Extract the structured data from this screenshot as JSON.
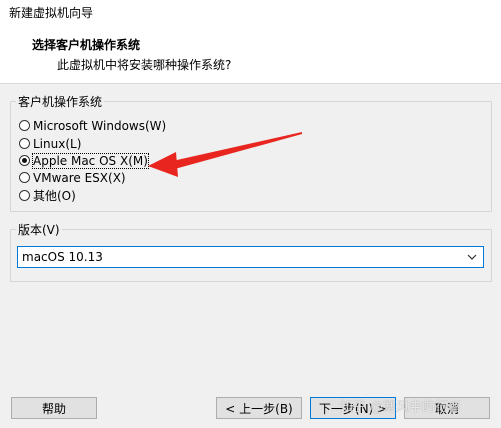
{
  "window": {
    "title": "新建虚拟机向导"
  },
  "header": {
    "title": "选择客户机操作系统",
    "subtitle": "此虚拟机中将安装哪种操作系统?"
  },
  "os_group": {
    "legend": "客户机操作系统",
    "options": [
      {
        "label": "Microsoft Windows(W)",
        "checked": false
      },
      {
        "label": "Linux(L)",
        "checked": false
      },
      {
        "label": "Apple Mac OS X(M)",
        "checked": true
      },
      {
        "label": "VMware ESX(X)",
        "checked": false
      },
      {
        "label": "其他(O)",
        "checked": false
      }
    ]
  },
  "version_group": {
    "legend": "版本(V)",
    "selected": "macOS 10.13"
  },
  "buttons": {
    "help": "帮助",
    "back": "< 上一步(B)",
    "next": "下一步(N) >",
    "cancel": "取消"
  },
  "annotation": {
    "color": "#e8261f"
  },
  "watermark": "知乎 @寒风中的行者"
}
